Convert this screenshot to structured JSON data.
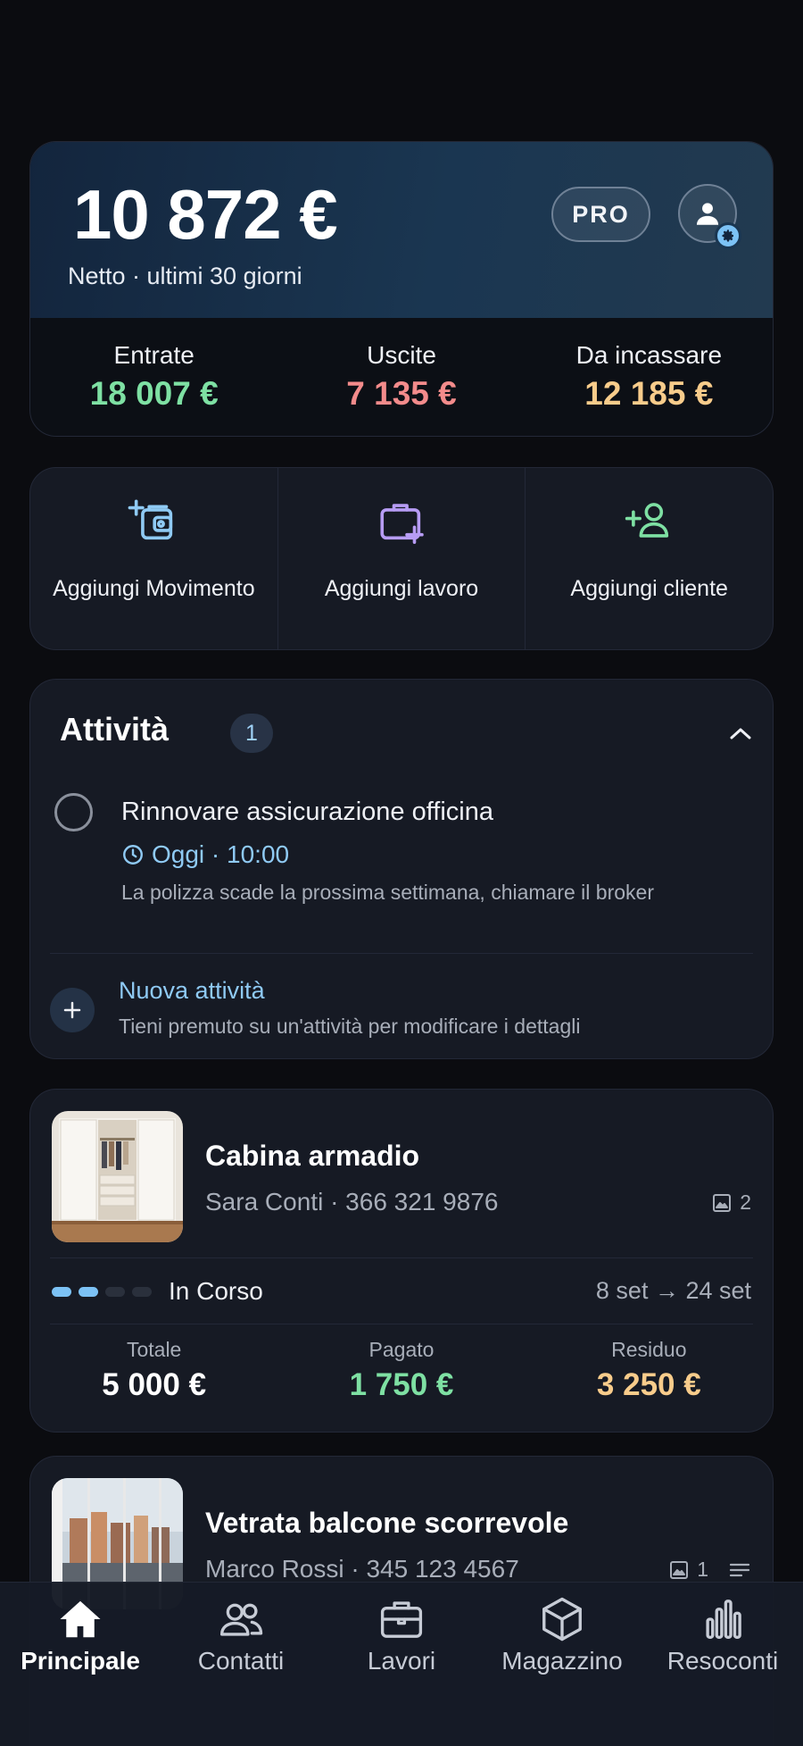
{
  "summary": {
    "net_amount": "10 872 €",
    "net_caption": "Netto · ultimi 30 giorni",
    "pro_badge": "PRO",
    "stats": [
      {
        "label": "Entrate",
        "value": "18 007 €"
      },
      {
        "label": "Uscite",
        "value": "7 135 €"
      },
      {
        "label": "Da incassare",
        "value": "12 185 €"
      }
    ]
  },
  "actions": [
    {
      "label": "Aggiungi Movimento",
      "icon": "add-transaction-icon",
      "color": "#8fcaf4"
    },
    {
      "label": "Aggiungi lavoro",
      "icon": "add-job-icon",
      "color": "#b79cf5"
    },
    {
      "label": "Aggiungi cliente",
      "icon": "add-client-icon",
      "color": "#7ee0a3"
    }
  ],
  "tasks": {
    "title": "Attività",
    "count": "1",
    "items": [
      {
        "title": "Rinnovare assicurazione officina",
        "time": "Oggi · 10:00",
        "description": "La polizza scade la prossima settimana, chiamare il broker"
      }
    ],
    "new_label": "Nuova attività",
    "hint": "Tieni premuto su un'attività per modificare i dettagli"
  },
  "jobs": [
    {
      "title": "Cabina armadio",
      "client": "Sara Conti",
      "phone": "· 366 321 9876",
      "photos": "2",
      "status": "In Corso",
      "progress_steps": 4,
      "progress_done": 2,
      "dates": "8 set → 24 set",
      "money": [
        {
          "label": "Totale",
          "value": "5 000 €"
        },
        {
          "label": "Pagato",
          "value": "1 750 €"
        },
        {
          "label": "Residuo",
          "value": "3 250 €"
        }
      ]
    },
    {
      "title": "Vetrata balcone scorrevole",
      "client": "Marco Rossi",
      "phone": "· 345 123 4567",
      "photos": "1"
    }
  ],
  "nav": [
    {
      "label": "Principale",
      "icon": "home-icon",
      "active": true
    },
    {
      "label": "Contatti",
      "icon": "contacts-icon",
      "active": false
    },
    {
      "label": "Lavori",
      "icon": "briefcase-icon",
      "active": false
    },
    {
      "label": "Magazzino",
      "icon": "box-icon",
      "active": false
    },
    {
      "label": "Resoconti",
      "icon": "chart-icon",
      "active": false
    }
  ],
  "colors": {
    "income": "#7ee0a3",
    "expense": "#f38b8b",
    "pending": "#f8cc8b",
    "accent": "#8fcaf4"
  }
}
